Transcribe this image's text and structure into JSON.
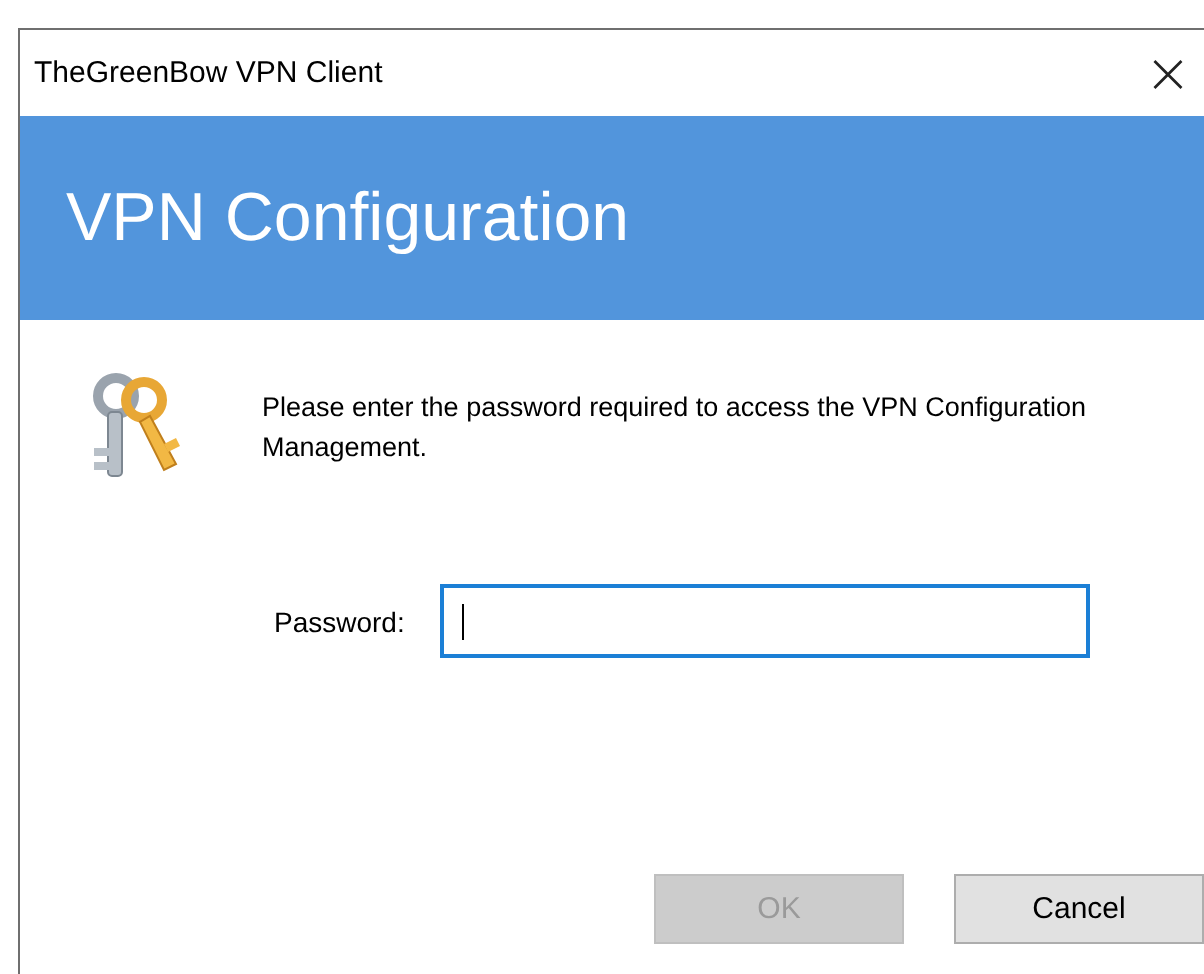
{
  "window": {
    "title": "TheGreenBow VPN Client",
    "close": "×"
  },
  "header": {
    "title": "VPN Configuration"
  },
  "message": "Please enter the password required to access the VPN Configuration Management.",
  "password": {
    "label": "Password:",
    "focused": true
  },
  "buttons": [
    {
      "label": "OK",
      "disabled": true
    },
    {
      "label": "Cancel",
      "disabled": false
    }
  ]
}
